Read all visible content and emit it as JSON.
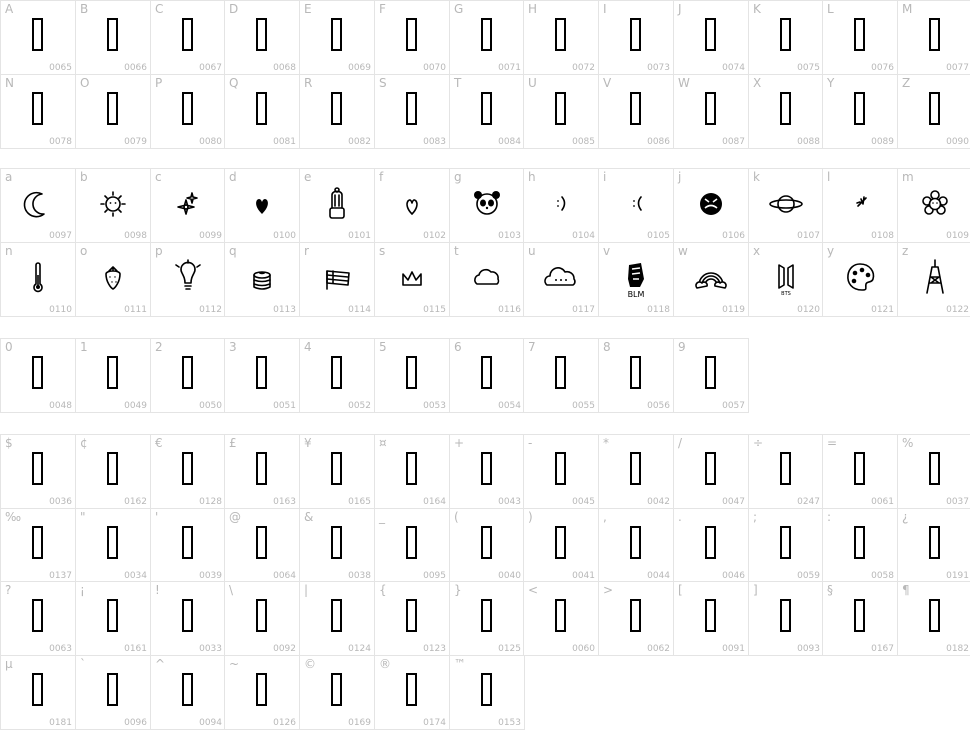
{
  "sections": [
    {
      "name": "uppercase",
      "rows": [
        [
          {
            "ch": "A",
            "code": "0065",
            "glyph": "box"
          },
          {
            "ch": "B",
            "code": "0066",
            "glyph": "box"
          },
          {
            "ch": "C",
            "code": "0067",
            "glyph": "box"
          },
          {
            "ch": "D",
            "code": "0068",
            "glyph": "box"
          },
          {
            "ch": "E",
            "code": "0069",
            "glyph": "box"
          },
          {
            "ch": "F",
            "code": "0070",
            "glyph": "box"
          },
          {
            "ch": "G",
            "code": "0071",
            "glyph": "box"
          },
          {
            "ch": "H",
            "code": "0072",
            "glyph": "box"
          },
          {
            "ch": "I",
            "code": "0073",
            "glyph": "box"
          },
          {
            "ch": "J",
            "code": "0074",
            "glyph": "box"
          },
          {
            "ch": "K",
            "code": "0075",
            "glyph": "box"
          },
          {
            "ch": "L",
            "code": "0076",
            "glyph": "box"
          },
          {
            "ch": "M",
            "code": "0077",
            "glyph": "box"
          }
        ],
        [
          {
            "ch": "N",
            "code": "0078",
            "glyph": "box"
          },
          {
            "ch": "O",
            "code": "0079",
            "glyph": "box"
          },
          {
            "ch": "P",
            "code": "0080",
            "glyph": "box"
          },
          {
            "ch": "Q",
            "code": "0081",
            "glyph": "box"
          },
          {
            "ch": "R",
            "code": "0082",
            "glyph": "box"
          },
          {
            "ch": "S",
            "code": "0083",
            "glyph": "box"
          },
          {
            "ch": "T",
            "code": "0084",
            "glyph": "box"
          },
          {
            "ch": "U",
            "code": "0085",
            "glyph": "box"
          },
          {
            "ch": "V",
            "code": "0086",
            "glyph": "box"
          },
          {
            "ch": "W",
            "code": "0087",
            "glyph": "box"
          },
          {
            "ch": "X",
            "code": "0088",
            "glyph": "box"
          },
          {
            "ch": "Y",
            "code": "0089",
            "glyph": "box"
          },
          {
            "ch": "Z",
            "code": "0090",
            "glyph": "box"
          }
        ]
      ]
    },
    {
      "name": "lowercase",
      "rows": [
        [
          {
            "ch": "a",
            "code": "0097",
            "glyph": "moon"
          },
          {
            "ch": "b",
            "code": "0098",
            "glyph": "sun"
          },
          {
            "ch": "c",
            "code": "0099",
            "glyph": "sparkles"
          },
          {
            "ch": "d",
            "code": "0100",
            "glyph": "heart-filled"
          },
          {
            "ch": "e",
            "code": "0101",
            "glyph": "cactus"
          },
          {
            "ch": "f",
            "code": "0102",
            "glyph": "heart-outline"
          },
          {
            "ch": "g",
            "code": "0103",
            "glyph": "panda"
          },
          {
            "ch": "h",
            "code": "0104",
            "glyph": "smile"
          },
          {
            "ch": "i",
            "code": "0105",
            "glyph": "frown"
          },
          {
            "ch": "j",
            "code": "0106",
            "glyph": "crying-face"
          },
          {
            "ch": "k",
            "code": "0107",
            "glyph": "planet"
          },
          {
            "ch": "l",
            "code": "0108",
            "glyph": "plane"
          },
          {
            "ch": "m",
            "code": "0109",
            "glyph": "flower"
          }
        ],
        [
          {
            "ch": "n",
            "code": "0110",
            "glyph": "thermometer"
          },
          {
            "ch": "o",
            "code": "0111",
            "glyph": "strawberry"
          },
          {
            "ch": "p",
            "code": "0112",
            "glyph": "lightbulb"
          },
          {
            "ch": "q",
            "code": "0113",
            "glyph": "cake"
          },
          {
            "ch": "r",
            "code": "0114",
            "glyph": "flag"
          },
          {
            "ch": "s",
            "code": "0115",
            "glyph": "crown"
          },
          {
            "ch": "t",
            "code": "0116",
            "glyph": "cloud"
          },
          {
            "ch": "u",
            "code": "0117",
            "glyph": "cloud-face"
          },
          {
            "ch": "v",
            "code": "0118",
            "glyph": "fist",
            "text": "BLM"
          },
          {
            "ch": "w",
            "code": "0119",
            "glyph": "rainbow"
          },
          {
            "ch": "x",
            "code": "0120",
            "glyph": "bts-logo",
            "text": "BTS"
          },
          {
            "ch": "y",
            "code": "0121",
            "glyph": "palette"
          },
          {
            "ch": "z",
            "code": "0122",
            "glyph": "tower"
          }
        ]
      ]
    },
    {
      "name": "digits",
      "rows": [
        [
          {
            "ch": "0",
            "code": "0048",
            "glyph": "box"
          },
          {
            "ch": "1",
            "code": "0049",
            "glyph": "box"
          },
          {
            "ch": "2",
            "code": "0050",
            "glyph": "box"
          },
          {
            "ch": "3",
            "code": "0051",
            "glyph": "box"
          },
          {
            "ch": "4",
            "code": "0052",
            "glyph": "box"
          },
          {
            "ch": "5",
            "code": "0053",
            "glyph": "box"
          },
          {
            "ch": "6",
            "code": "0054",
            "glyph": "box"
          },
          {
            "ch": "7",
            "code": "0055",
            "glyph": "box"
          },
          {
            "ch": "8",
            "code": "0056",
            "glyph": "box"
          },
          {
            "ch": "9",
            "code": "0057",
            "glyph": "box"
          }
        ]
      ]
    },
    {
      "name": "symbols",
      "rows": [
        [
          {
            "ch": "$",
            "code": "0036",
            "glyph": "box"
          },
          {
            "ch": "¢",
            "code": "0162",
            "glyph": "box"
          },
          {
            "ch": "€",
            "code": "0128",
            "glyph": "box"
          },
          {
            "ch": "£",
            "code": "0163",
            "glyph": "box"
          },
          {
            "ch": "¥",
            "code": "0165",
            "glyph": "box"
          },
          {
            "ch": "¤",
            "code": "0164",
            "glyph": "box"
          },
          {
            "ch": "+",
            "code": "0043",
            "glyph": "box"
          },
          {
            "ch": "-",
            "code": "0045",
            "glyph": "box"
          },
          {
            "ch": "*",
            "code": "0042",
            "glyph": "box"
          },
          {
            "ch": "/",
            "code": "0047",
            "glyph": "box"
          },
          {
            "ch": "÷",
            "code": "0247",
            "glyph": "box"
          },
          {
            "ch": "=",
            "code": "0061",
            "glyph": "box"
          },
          {
            "ch": "%",
            "code": "0037",
            "glyph": "box"
          }
        ],
        [
          {
            "ch": "‰",
            "code": "0137",
            "glyph": "box"
          },
          {
            "ch": "\"",
            "code": "0034",
            "glyph": "box"
          },
          {
            "ch": "'",
            "code": "0039",
            "glyph": "box"
          },
          {
            "ch": "@",
            "code": "0064",
            "glyph": "box"
          },
          {
            "ch": "&",
            "code": "0038",
            "glyph": "box"
          },
          {
            "ch": "_",
            "code": "0095",
            "glyph": "box"
          },
          {
            "ch": "(",
            "code": "0040",
            "glyph": "box"
          },
          {
            "ch": ")",
            "code": "0041",
            "glyph": "box"
          },
          {
            "ch": ",",
            "code": "0044",
            "glyph": "box"
          },
          {
            "ch": ".",
            "code": "0046",
            "glyph": "box"
          },
          {
            "ch": ";",
            "code": "0059",
            "glyph": "box"
          },
          {
            "ch": ":",
            "code": "0058",
            "glyph": "box"
          },
          {
            "ch": "¿",
            "code": "0191",
            "glyph": "box"
          }
        ],
        [
          {
            "ch": "?",
            "code": "0063",
            "glyph": "box"
          },
          {
            "ch": "¡",
            "code": "0161",
            "glyph": "box"
          },
          {
            "ch": "!",
            "code": "0033",
            "glyph": "box"
          },
          {
            "ch": "\\",
            "code": "0092",
            "glyph": "box"
          },
          {
            "ch": "|",
            "code": "0124",
            "glyph": "box"
          },
          {
            "ch": "{",
            "code": "0123",
            "glyph": "box"
          },
          {
            "ch": "}",
            "code": "0125",
            "glyph": "box"
          },
          {
            "ch": "<",
            "code": "0060",
            "glyph": "box"
          },
          {
            "ch": ">",
            "code": "0062",
            "glyph": "box"
          },
          {
            "ch": "[",
            "code": "0091",
            "glyph": "box"
          },
          {
            "ch": "]",
            "code": "0093",
            "glyph": "box"
          },
          {
            "ch": "§",
            "code": "0167",
            "glyph": "box"
          },
          {
            "ch": "¶",
            "code": "0182",
            "glyph": "box"
          }
        ],
        [
          {
            "ch": "µ",
            "code": "0181",
            "glyph": "box"
          },
          {
            "ch": "`",
            "code": "0096",
            "glyph": "box"
          },
          {
            "ch": "^",
            "code": "0094",
            "glyph": "box"
          },
          {
            "ch": "~",
            "code": "0126",
            "glyph": "box"
          },
          {
            "ch": "©",
            "code": "0169",
            "glyph": "box"
          },
          {
            "ch": "®",
            "code": "0174",
            "glyph": "box"
          },
          {
            "ch": "™",
            "code": "0153",
            "glyph": "box"
          }
        ]
      ]
    }
  ]
}
